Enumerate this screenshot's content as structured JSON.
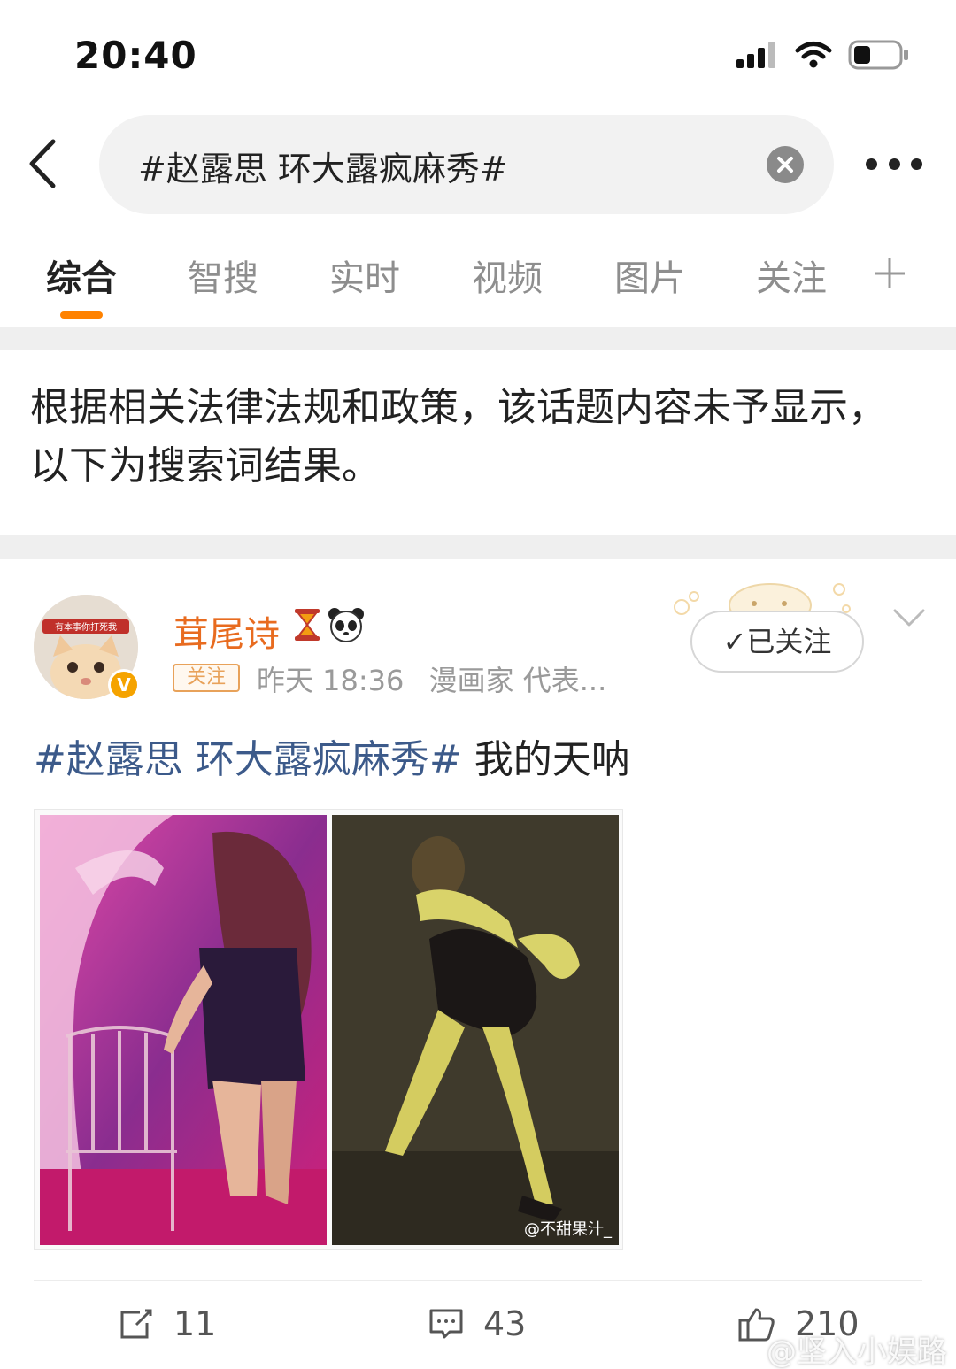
{
  "status_bar": {
    "time": "20:40",
    "icons": [
      "signal-icon",
      "wifi-icon",
      "battery-icon"
    ]
  },
  "header": {
    "search_query": "#赵露思 环大露疯麻秀#",
    "icons": [
      "back-arrow-icon",
      "clear-icon",
      "more-icon"
    ]
  },
  "tabs": [
    {
      "label": "综合",
      "active": true
    },
    {
      "label": "智搜",
      "active": false
    },
    {
      "label": "实时",
      "active": false
    },
    {
      "label": "视频",
      "active": false
    },
    {
      "label": "图片",
      "active": false
    },
    {
      "label": "关注",
      "active": false
    }
  ],
  "notice": "根据相关法律法规和政策，该话题内容未予显示，以下为搜索词结果。",
  "post": {
    "avatar_caption": "有本事你打死我",
    "verified_badge": "V",
    "username": "茸尾诗",
    "follow_tag": "关注",
    "time": "昨天 18:36",
    "source": "漫画家 代表...",
    "followed_button": "✓已关注",
    "hashtag": "#赵露思 环大露疯麻秀#",
    "text": " 我的天呐",
    "image_watermark": "@不甜果汁_",
    "actions": {
      "repost_count": "11",
      "comment_count": "43",
      "like_count": "210"
    }
  },
  "colors": {
    "accent_orange": "#ff8200",
    "username": "#e86b1f",
    "hashtag_blue": "#3c5a8a"
  },
  "corner_watermark": "@坚入小娱路"
}
